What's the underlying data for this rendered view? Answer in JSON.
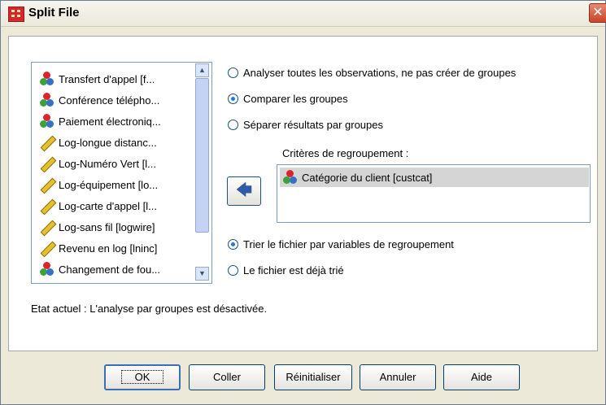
{
  "window": {
    "title": "Split File",
    "close_glyph": "✕"
  },
  "variables": [
    {
      "label": "Transfert d'appel [f...",
      "icon": "nominal-icon"
    },
    {
      "label": "Conférence télépho...",
      "icon": "nominal-icon"
    },
    {
      "label": "Paiement électroniq...",
      "icon": "nominal-icon"
    },
    {
      "label": "Log-longue distanc...",
      "icon": "scale-icon"
    },
    {
      "label": "Log-Numéro Vert [l...",
      "icon": "scale-icon"
    },
    {
      "label": "Log-équipement [lo...",
      "icon": "scale-icon"
    },
    {
      "label": "Log-carte d'appel [l...",
      "icon": "scale-icon"
    },
    {
      "label": "Log-sans fil [logwire]",
      "icon": "scale-icon"
    },
    {
      "label": "Revenu en log [lninc]",
      "icon": "scale-icon"
    },
    {
      "label": "Changement de fou...",
      "icon": "nominal-icon"
    }
  ],
  "group_options": [
    {
      "label": "Analyser toutes les observations, ne pas créer de groupes",
      "checked": false
    },
    {
      "label": "Comparer les groupes",
      "checked": true
    },
    {
      "label": "Séparer résultats par groupes",
      "checked": false
    }
  ],
  "criteria": {
    "label": "Critères de regroupement :",
    "items": [
      "Catégorie du client [custcat]"
    ]
  },
  "move_button_glyph": "🡄",
  "sort_options": [
    {
      "label": "Trier le fichier par variables de regroupement",
      "checked": true
    },
    {
      "label": "Le fichier est déjà trié",
      "checked": false
    }
  ],
  "status": "Etat actuel : L'analyse par groupes est désactivée.",
  "buttons": {
    "ok": "OK",
    "paste": "Coller",
    "reset": "Réinitialiser",
    "cancel": "Annuler",
    "help": "Aide"
  },
  "colors": {
    "nominal_red": "#d9262d",
    "nominal_green": "#3aa23a",
    "nominal_blue": "#3572c6",
    "scale_yellow": "#e6c12e"
  }
}
